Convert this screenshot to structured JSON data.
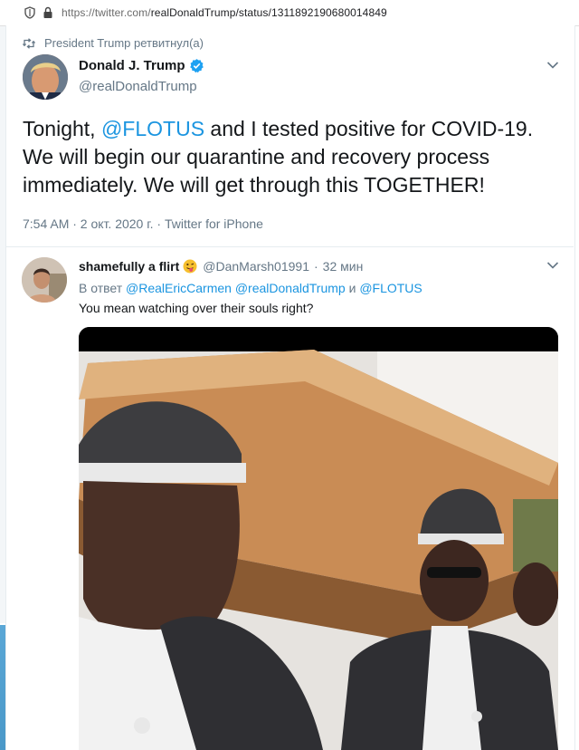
{
  "browser": {
    "url_prefix": "https://twitter.com/",
    "url_path": "realDonaldTrump/status/1311892190680014849"
  },
  "retweet_context": {
    "label": "President Trump ретвитнул(а)"
  },
  "tweet": {
    "author_name": "Donald J. Trump",
    "author_handle": "@realDonaldTrump",
    "text_part1": "Tonight, ",
    "mention": "@FLOTUS",
    "text_part2": " and I tested positive for COVID-19. We will begin our quarantine and recovery process immediately. We will get through this TOGETHER!",
    "timestamp": "7:54 AM · 2 окт. 2020 г. · Twitter for iPhone",
    "verified_color": "#1da1f2"
  },
  "reply": {
    "author_name": "shamefully a flirt",
    "author_handle": "@DanMarsh01991",
    "separator": "·",
    "time_ago": "32 мин",
    "replying_prefix": "В ответ",
    "replying_to_1": "@RealEricCarmen",
    "replying_to_2": "@realDonaldTrump",
    "replying_and": "и",
    "replying_to_3": "@FLOTUS",
    "text": "You mean watching over their souls right?"
  },
  "colors": {
    "link": "#1b95e0",
    "secondary_text": "#657786",
    "primary_text": "#14171a"
  }
}
